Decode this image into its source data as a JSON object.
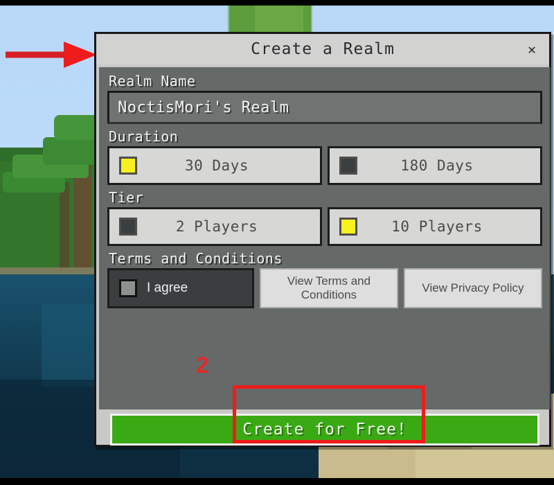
{
  "dialog": {
    "title": "Create a Realm",
    "close_icon": "close-icon",
    "realm_name": {
      "label": "Realm Name",
      "value": "NoctisMori's Realm"
    },
    "duration": {
      "label": "Duration",
      "options": [
        {
          "label": "30 Days",
          "selected": true
        },
        {
          "label": "180 Days",
          "selected": false
        }
      ]
    },
    "tier": {
      "label": "Tier",
      "options": [
        {
          "label": "2 Players",
          "selected": false
        },
        {
          "label": "10 Players",
          "selected": true
        }
      ]
    },
    "terms": {
      "label": "Terms and Conditions",
      "agree_label": "I agree",
      "agree_checked": false,
      "view_terms_label": "View Terms and Conditions",
      "view_privacy_label": "View Privacy Policy"
    },
    "cta": {
      "label": "Create for Free!"
    }
  },
  "annotations": {
    "step_number": "2",
    "arrow_color": "#ee1c1c",
    "highlight_color": "#ee1c1c"
  },
  "colors": {
    "selected_checkbox": "#f7f11f",
    "unselected_checkbox": "#3c3f40",
    "cta_green": "#3aaa14",
    "dialog_chrome": "#d2d2d0",
    "panel_overlay": "#565c5c"
  }
}
